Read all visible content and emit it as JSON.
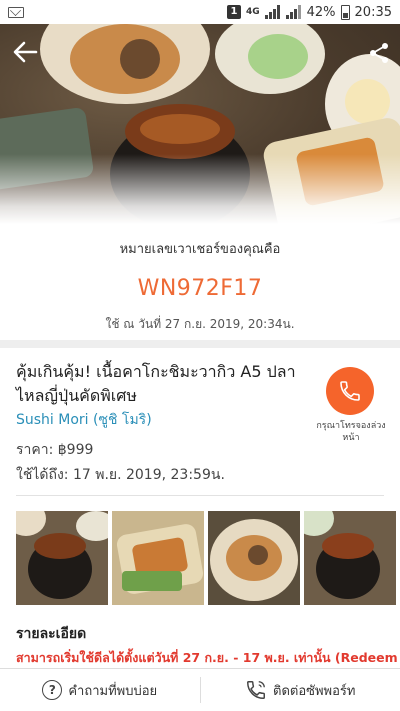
{
  "status_bar": {
    "notif_badge": "1",
    "network": "4G",
    "battery_percent": "42%",
    "time": "20:35"
  },
  "hero": {
    "back_icon": "arrow-left-icon",
    "share_icon": "share-icon"
  },
  "voucher": {
    "label": "หมายเลขเวาเชอร์ของคุณคือ",
    "code": "WN972F17",
    "used_text": "ใช้ ณ วันที่ 27 ก.ย. 2019, 20:34น."
  },
  "deal": {
    "title": "คุ้มเกินคุ้ม! เนื้อคาโกะชิมะวากิว A5 ปลาไหลญี่ปุ่นคัดพิเศษ",
    "merchant": "Sushi Mori (ซูชิ โมริ)",
    "price": "ราคา: ฿999",
    "valid_until": "ใช้ได้ถึง: 17 พ.ย. 2019, 23:59น.",
    "call_label": "กรุณาโทรจองล่วงหน้า"
  },
  "details": {
    "heading": "รายละเอียด",
    "highlight": "สามารถเริ่มใช้ดีลได้ตั้งแต่วันที่ 27 ก.ย. - 17 พ.ย. เท่านั้น (Redeem"
  },
  "bottom_bar": {
    "faq_label": "คำถามที่พบบ่อย",
    "support_label": "ติดต่อซัพพอร์ท"
  },
  "colors": {
    "accent": "#ee6a35",
    "call_button": "#f5642b",
    "merchant_link": "#2a8fb8",
    "details_red": "#e23a2f"
  }
}
